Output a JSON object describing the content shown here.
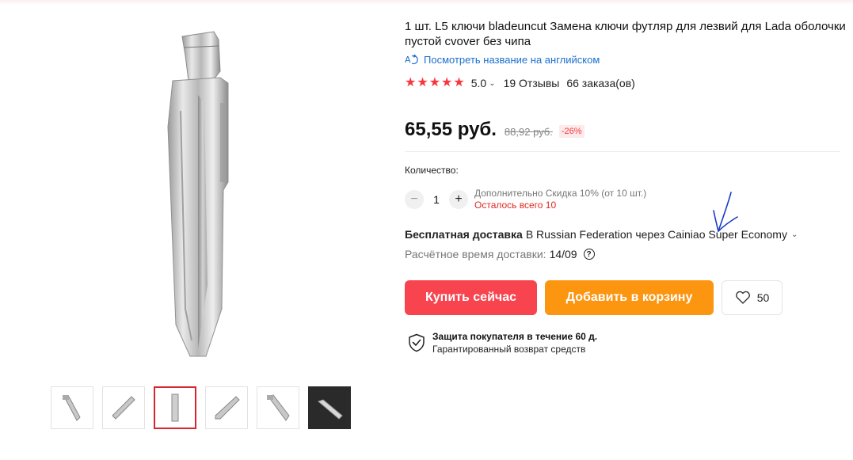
{
  "product": {
    "title": "1 шт. L5 ключи bladeuncut Замена ключи футляр для лезвий для Lada оболочки пустой cvover без чипа",
    "translate_link": "Посмотреть название на английском",
    "rating": "5.0",
    "reviews": "19 Отзывы",
    "orders": "66 заказа(ов)",
    "price": "65,55 руб.",
    "old_price": "88,92 руб.",
    "discount": "-26%"
  },
  "quantity": {
    "label": "Количество:",
    "value": "1",
    "discount_note": "Дополнительно Скидка 10% (от 10 шт.)",
    "stock_note": "Осталось всего 10"
  },
  "shipping": {
    "free_label": "Бесплатная доставка",
    "details": "В Russian Federation через Cainiao Super Economy",
    "eta_label": "Расчётное время доставки:",
    "eta_date": "14/09"
  },
  "actions": {
    "buy_now": "Купить сейчас",
    "add_to_cart": "Добавить в корзину",
    "wishlist_count": "50"
  },
  "protection": {
    "title": "Защита покупателя в течение 60 д.",
    "subtitle": "Гарантированный возврат средств"
  },
  "gallery": {
    "selected_index": 2,
    "thumbnail_count": 6
  },
  "colors": {
    "accent_red": "#f7444e",
    "accent_orange": "#fc9510",
    "link_blue": "#1b6fcc",
    "star": "#f7383f"
  }
}
